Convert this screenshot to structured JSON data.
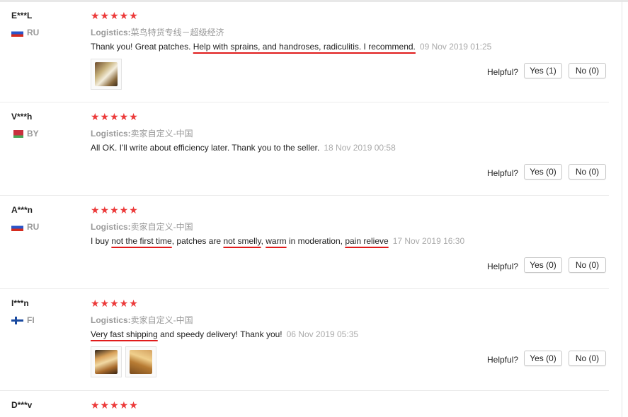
{
  "reviews": [
    {
      "user": "E***L",
      "country": "RU",
      "flag": "ru",
      "stars": "★★★★★",
      "logistics_label": "Logistics:",
      "logistics_value": "菜鸟特货专线－超级经济",
      "text_parts": [
        "Thank you! Great patches. ",
        "Help with sprains, and handroses, radiculitis. I recommend."
      ],
      "date": "09 Nov 2019 01:25",
      "helpful_label": "Helpful?",
      "yes_label": "Yes (1)",
      "no_label": "No (0)",
      "photos": [
        "product-photo"
      ]
    },
    {
      "user": "V***h",
      "country": "BY",
      "flag": "by",
      "stars": "★★★★★",
      "logistics_label": "Logistics:",
      "logistics_value": "卖家自定义-中国",
      "text_parts": [
        "All OK. I'll write about efficiency later. Thank you to the seller."
      ],
      "date": "18 Nov 2019 00:58",
      "helpful_label": "Helpful?",
      "yes_label": "Yes (0)",
      "no_label": "No (0)"
    },
    {
      "user": "A***n",
      "country": "RU",
      "flag": "ru",
      "stars": "★★★★★",
      "logistics_label": "Logistics:",
      "logistics_value": "卖家自定义-中国",
      "text_parts": [
        "I buy ",
        "not the first time",
        ", patches are ",
        "not smelly",
        ", ",
        "warm",
        " in moderation, ",
        "pain relieve"
      ],
      "date": "17 Nov 2019 16:30",
      "helpful_label": "Helpful?",
      "yes_label": "Yes (0)",
      "no_label": "No (0)"
    },
    {
      "user": "I***n",
      "country": "FI",
      "flag": "fi",
      "stars": "★★★★★",
      "logistics_label": "Logistics:",
      "logistics_value": "卖家自定义-中国",
      "text_parts": [
        "Very fast shipping",
        " and speedy delivery! Thank you!"
      ],
      "date": "06 Nov 2019 05:35",
      "helpful_label": "Helpful?",
      "yes_label": "Yes (0)",
      "no_label": "No (0)",
      "photos": [
        "product-photo",
        "product-photo"
      ]
    },
    {
      "user": "D***v",
      "stars": "★★★★★"
    }
  ],
  "colors": {
    "star": "#ec3a3a",
    "underline_annotation": "#e01b1b",
    "meta_text": "#999999"
  }
}
